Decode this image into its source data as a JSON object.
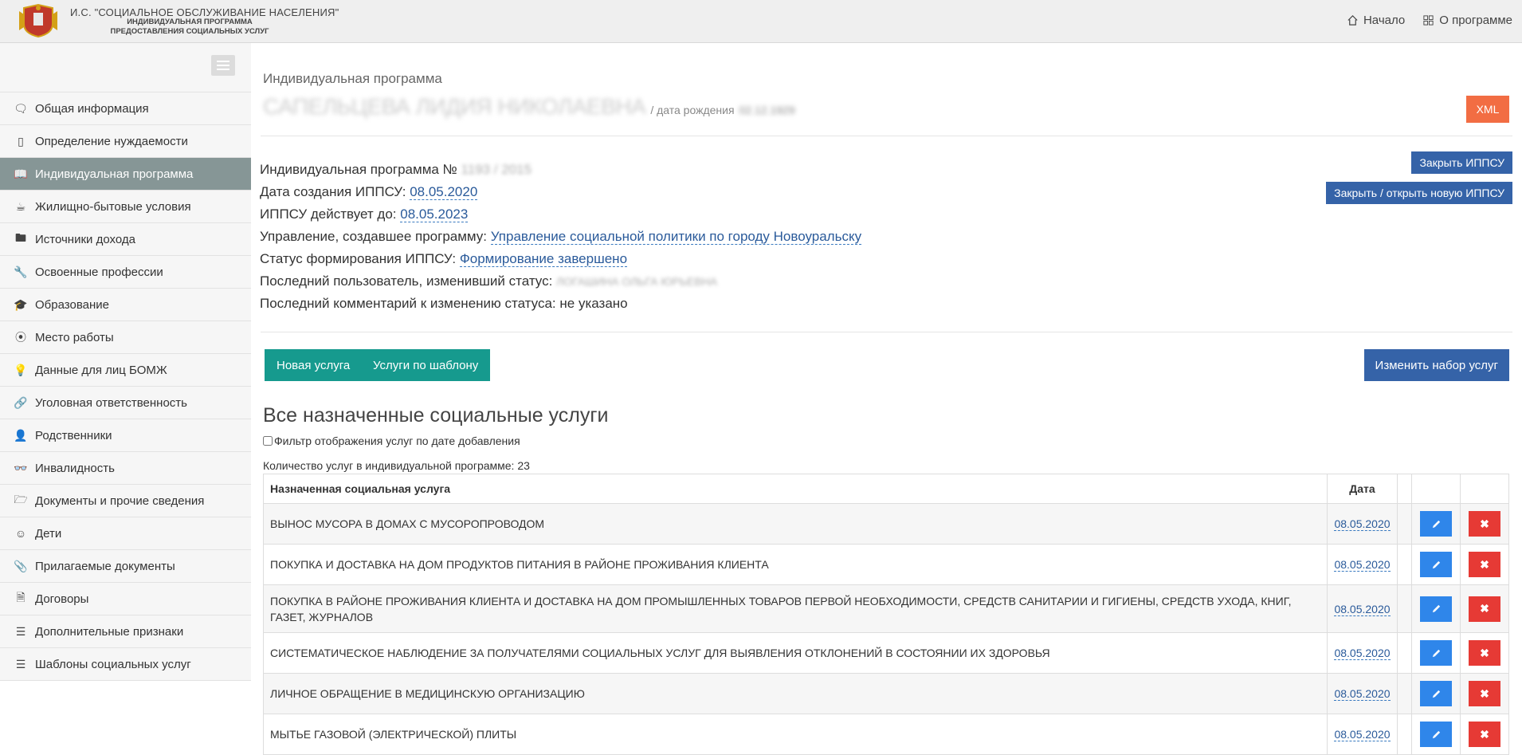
{
  "header": {
    "title_line1": "И.С. \"СОЦИАЛЬНОЕ ОБСЛУЖИВАНИЕ НАСЕЛЕНИЯ\"",
    "title_line2": "ИНДИВИДУАЛЬНАЯ ПРОГРАММА",
    "title_line3": "ПРЕДОСТАВЛЕНИЯ СОЦИАЛЬНЫХ УСЛУГ",
    "nav_home": "Начало",
    "nav_about": "О программе"
  },
  "sidebar": {
    "items": [
      {
        "label": "Общая информация",
        "icon": "chat-icon"
      },
      {
        "label": "Определение нуждаемости",
        "icon": "document-icon"
      },
      {
        "label": "Индивидуальная программа",
        "icon": "book-icon",
        "active": true
      },
      {
        "label": "Жилищно-бытовые условия",
        "icon": "cup-icon"
      },
      {
        "label": "Источники дохода",
        "icon": "folder-icon"
      },
      {
        "label": "Освоенные профессии",
        "icon": "wrench-icon"
      },
      {
        "label": "Образование",
        "icon": "graduation-cap-icon"
      },
      {
        "label": "Место работы",
        "icon": "compass-icon"
      },
      {
        "label": "Данные для лиц БОМЖ",
        "icon": "bulb-icon"
      },
      {
        "label": "Уголовная ответственность",
        "icon": "link-icon"
      },
      {
        "label": "Родственники",
        "icon": "user-icon"
      },
      {
        "label": "Инвалидность",
        "icon": "glasses-icon"
      },
      {
        "label": "Документы и прочие сведения",
        "icon": "folder-open-icon"
      },
      {
        "label": "Дети",
        "icon": "smile-icon"
      },
      {
        "label": "Прилагаемые документы",
        "icon": "paperclip-icon"
      },
      {
        "label": "Договоры",
        "icon": "file-icon"
      },
      {
        "label": "Дополнительные признаки",
        "icon": "list-icon"
      },
      {
        "label": "Шаблоны социальных услуг",
        "icon": "list-icon"
      }
    ]
  },
  "main": {
    "crumb": "Индивидуальная программа",
    "person_name": "САПЕЛЬЦЕВА ЛИДИЯ НИКОЛАЕВНА",
    "dob_label": "/ дата рождения",
    "dob_value": "02.12.1929",
    "xml_label": "XML",
    "info": {
      "prog_label": "Индивидуальная программа №",
      "prog_value": "1193 / 2015",
      "created_label": "Дата создания ИППСУ:",
      "created_value": "08.05.2020",
      "valid_label": "ИППСУ действует до:",
      "valid_value": "08.05.2023",
      "dept_label": "Управление, создавшее программу:",
      "dept_value": "Управление социальной политики по городу Новоуральску",
      "status_label": "Статус формирования ИППСУ:",
      "status_value": "Формирование завершено",
      "user_label": "Последний пользователь, изменивший статус:",
      "user_value": "ЛОГАШИНА ОЛЬГА ЮРЬЕВНА",
      "comment_label": "Последний комментарий к изменению статуса:",
      "comment_value": "не указано"
    },
    "btn_close": "Закрыть ИППСУ",
    "btn_close_open": "Закрыть / открыть новую ИППСУ",
    "btn_new": "Новая услуга",
    "btn_template": "Услуги по шаблону",
    "btn_change": "Изменить набор услуг",
    "section_title": "Все назначенные социальные услуги",
    "filter_label": "Фильтр отображения услуг по дате добавления",
    "count_label": "Количество услуг в индивидуальной программе: 23",
    "table": {
      "col_service": "Назначенная социальная услуга",
      "col_date": "Дата",
      "rows": [
        {
          "service": "ВЫНОС МУСОРА В ДОМАХ С МУСОРОПРОВОДОМ",
          "date": "08.05.2020"
        },
        {
          "service": "ПОКУПКА И ДОСТАВКА НА ДОМ ПРОДУКТОВ ПИТАНИЯ В РАЙОНЕ ПРОЖИВАНИЯ КЛИЕНТА",
          "date": "08.05.2020"
        },
        {
          "service": "ПОКУПКА В РАЙОНЕ ПРОЖИВАНИЯ КЛИЕНТА И ДОСТАВКА НА ДОМ ПРОМЫШЛЕННЫХ ТОВАРОВ ПЕРВОЙ НЕОБХОДИМОСТИ, СРЕДСТВ САНИТАРИИ И ГИГИЕНЫ, СРЕДСТВ УХОДА, КНИГ, ГАЗЕТ, ЖУРНАЛОВ",
          "date": "08.05.2020"
        },
        {
          "service": "СИСТЕМАТИЧЕСКОЕ НАБЛЮДЕНИЕ ЗА ПОЛУЧАТЕЛЯМИ СОЦИАЛЬНЫХ УСЛУГ ДЛЯ ВЫЯВЛЕНИЯ ОТКЛОНЕНИЙ В СОСТОЯНИИ ИХ ЗДОРОВЬЯ",
          "date": "08.05.2020"
        },
        {
          "service": "ЛИЧНОЕ ОБРАЩЕНИЕ В МЕДИЦИНСКУЮ ОРГАНИЗАЦИЮ",
          "date": "08.05.2020"
        },
        {
          "service": "МЫТЬЕ ГАЗОВОЙ (ЭЛЕКТРИЧЕСКОЙ) ПЛИТЫ",
          "date": "08.05.2020"
        }
      ]
    }
  },
  "colors": {
    "active_sidebar": "#869696",
    "teal": "#169a8e",
    "blue": "#3563a8",
    "xml": "#f26d43",
    "edit": "#2f86ea",
    "delete": "#e63a35"
  }
}
